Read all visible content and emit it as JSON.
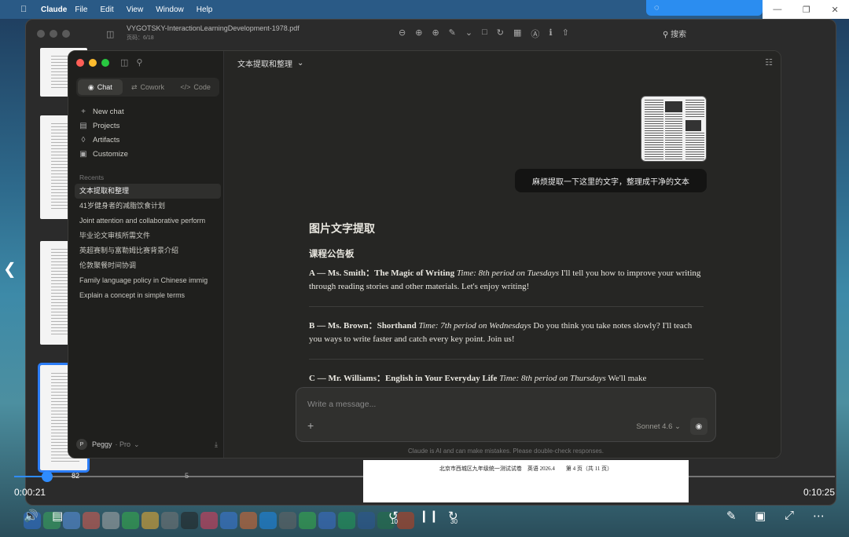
{
  "menubar": {
    "app_name": "Claude",
    "items": [
      "File",
      "Edit",
      "View",
      "Window",
      "Help"
    ]
  },
  "pdf_viewer": {
    "title": "VYGOTSKY-InteractionLearningDevelopment-1978.pdf",
    "subtitle": "页码：6/18",
    "search_label": "搜索",
    "thumb_numbers": [
      "82",
      "5"
    ],
    "page_footer": "北京市西城区九年级统一测试试卷　英语 2026.4　　第 4 页（共 11 页）"
  },
  "sidebar": {
    "tabs": [
      "Chat",
      "Cowork",
      "Code"
    ],
    "nav": [
      "New chat",
      "Projects",
      "Artifacts",
      "Customize"
    ],
    "recents_title": "Recents",
    "recents": [
      "文本提取和整理",
      "41岁健身者的减脂饮食计划",
      "Joint attention and collaborative perform",
      "毕业论文审核所需文件",
      "英超赛制与富勒姆比赛背景介绍",
      "伦敦聚餐时间协调",
      "Family language policy in Chinese immig",
      "Explain a concept in simple terms"
    ],
    "user": {
      "initial": "P",
      "name": "Peggy",
      "plan": "· Pro"
    }
  },
  "main": {
    "conversation_title": "文本提取和整理",
    "user_message": "麻烦提取一下这里的文字，整理成干净的文本",
    "response": {
      "h1": "图片文字提取",
      "h2": "课程公告板",
      "entries": [
        {
          "head": "A — Ms. Smith：The Magic of Writing",
          "time": "Time: 8th period on Tuesdays",
          "body": "I'll tell you how to improve your writing through reading stories and other materials. Let's enjoy writing!"
        },
        {
          "head": "B — Ms. Brown：Shorthand",
          "time": "Time: 7th period on Wednesdays",
          "body": "Do you think you take notes slowly? I'll teach you ways to write faster and catch every key point. Join us!"
        },
        {
          "head": "C — Mr. Williams：English in Your Everyday Life",
          "time": "Time: 8th period on Thursdays",
          "body": "We'll make"
        }
      ]
    },
    "composer": {
      "placeholder": "Write a message...",
      "model": "Sonnet 4.6"
    },
    "disclaimer": "Claude is AI and can make mistakes. Please double-check responses."
  },
  "player": {
    "current_time": "0:00:21",
    "total_time": "0:10:25",
    "progress_fraction": 0.04,
    "skip_back": "10",
    "skip_forward": "30"
  },
  "colors": {
    "accent": "#2f8cff",
    "claude_bg": "#262624",
    "sidebar_bg": "#1f1f1d"
  }
}
